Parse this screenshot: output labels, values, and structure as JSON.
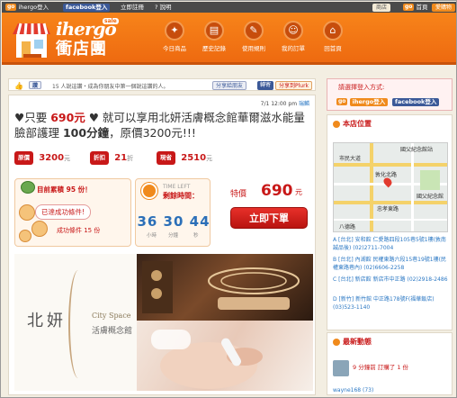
{
  "topbar": {
    "go_label": "go",
    "ihergo_login": "ihergo登入",
    "fb_label": "facebook登入",
    "register": "立即註冊",
    "help": "說明",
    "store_btn": "商店",
    "home_go": "go",
    "home_btn": "首頁",
    "shop_btn": "愛購物"
  },
  "header": {
    "logo_en": "ihergo",
    "logo_sale": "sale",
    "logo_zh": "衝店團",
    "nav": [
      {
        "label": "今日商品",
        "icon": "tag-icon"
      },
      {
        "label": "歷史記錄",
        "icon": "history-icon"
      },
      {
        "label": "使用規則",
        "icon": "rules-icon"
      },
      {
        "label": "我的訂單",
        "icon": "order-icon"
      },
      {
        "label": "回首頁",
        "icon": "home-icon"
      }
    ]
  },
  "likebar": {
    "like_label": "讚",
    "like_text": "15 人說這讚・成為你朋友中第一個說這讚的人。",
    "share_fb": "分享給朋友",
    "plurk": "分享到Plurk",
    "email": "轉寄"
  },
  "deal": {
    "datetime": "7/1 12:00 pm",
    "city": "瑞麟",
    "title_pre": "♥只要 ",
    "title_price": "690元",
    "title_mid": " ♥ 就可以享用北妍活膚概念館華爾滋水能量臉部護理 ",
    "title_duration": "100分鐘",
    "title_post": "，原價3200元!!!",
    "orig_label": "原價",
    "orig_value": "3200",
    "orig_unit": "元",
    "discount_label": "折扣",
    "discount_value": "21",
    "discount_unit": "折",
    "save_label": "現省",
    "save_value": "2510",
    "save_unit": "元",
    "sold_title": "目前累積 95 份！",
    "sold_ok": "已達成功條件!",
    "sold_cond": "成功條件 15 份",
    "timer_en": "TIME LEFT",
    "timer_zh": "剩餘時間：",
    "timer_digits": "36 30 44",
    "timer_hours": "小時",
    "timer_minutes": "分鐘",
    "timer_seconds": "秒",
    "special_label": "特價",
    "special_price": "690",
    "special_unit": "元",
    "buy_btn": "立即下單",
    "brand_zh": "北妍",
    "brand_en": "City Space",
    "brand_sub": "活膚概念館"
  },
  "sidebar": {
    "signin_title": "請選擇登入方式:",
    "signin_go": "go",
    "signin_ihergo": "ihergo登入",
    "signin_fb": "facebook登入",
    "store_title": "本店位置",
    "map_labels": [
      "國父紀念館站",
      "市民大道",
      "忠孝東路",
      "敦化北路",
      "國父紀念館",
      "八德路"
    ],
    "addresses": [
      {
        "text": "A [台北] 安和館 仁愛路四段105巷5號1樓(敦南誠品後) (02)2711-7004"
      },
      {
        "text": "B [台北] 內湖館 民權東路六段15巷19號1樓(民權東路巷內) (02)6606-2258"
      },
      {
        "text": "C [台北] 新店館 新店市中正路 (02)2918-2486"
      },
      {
        "text": "D [新竹] 新竹館 中正路178號F(福華飯店) (03)523-1140"
      }
    ],
    "activity_title": "最新動態",
    "activity_text": "9 分鐘前 訂購了 1 份",
    "activity_user": "wayne168 (73)"
  },
  "colors": {
    "brand_orange": "#f08a1c",
    "accent_red": "#c81818",
    "fb_blue": "#3b5998"
  }
}
